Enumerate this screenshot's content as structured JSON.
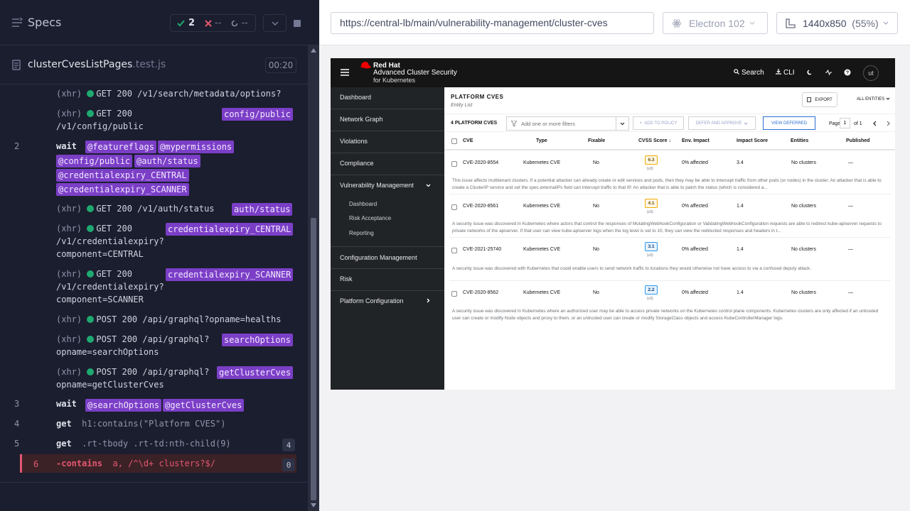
{
  "runner": {
    "specs_title": "Specs",
    "stats": {
      "passed": "2",
      "failed": "--",
      "pending": "--"
    },
    "spec_file": {
      "name": "clusterCvesListPages",
      "ext": ".test.js",
      "duration": "00:20"
    },
    "commands": {
      "c0_method": "(xhr)",
      "c0_text": "GET 200 /v1/search/metadata/options?",
      "c1_method": "(xhr)",
      "c1_text": "GET 200",
      "c1_text2": "/v1/config/public",
      "c1_alias": "config/public",
      "c2_num": "2",
      "c2_cmd": "wait",
      "c2_a1": "@featureflags",
      "c2_a2": "@mypermissions",
      "c2_a3": "@config/public",
      "c2_a4": "@auth/status",
      "c2_a5": "@credentialexpiry_CENTRAL",
      "c2_a6": "@credentialexpiry_SCANNER",
      "c3_method": "(xhr)",
      "c3_text": "GET 200 /v1/auth/status",
      "c3_alias": "auth/status",
      "c4_method": "(xhr)",
      "c4_text": "GET 200",
      "c4_text2": "/v1/credentialexpiry?",
      "c4_text3": "component=CENTRAL",
      "c4_alias": "credentialexpiry_CENTRAL",
      "c5_method": "(xhr)",
      "c5_text": "GET 200",
      "c5_text2": "/v1/credentialexpiry?",
      "c5_text3": "component=SCANNER",
      "c5_alias": "credentialexpiry_SCANNER",
      "c6_method": "(xhr)",
      "c6_text": "POST 200 /api/graphql?opname=healths",
      "c7_method": "(xhr)",
      "c7_text": "POST 200 /api/graphql?",
      "c7_text2": "opname=searchOptions",
      "c7_alias": "searchOptions",
      "c8_method": "(xhr)",
      "c8_text": "POST 200 /api/graphql?",
      "c8_text2": "opname=getClusterCves",
      "c8_alias": "getClusterCves",
      "c9_num": "3",
      "c9_cmd": "wait",
      "c9_a1": "@searchOptions",
      "c9_a2": "@getClusterCves",
      "c10_num": "4",
      "c10_cmd": "get",
      "c10_arg": "h1:contains(\"Platform CVES\")",
      "c11_num": "5",
      "c11_cmd": "get",
      "c11_arg": ".rt-tbody .rt-td:nth-child(9)",
      "c11_count": "4",
      "c12_num": "6",
      "c12_cmd": "-contains",
      "c12_arg": "a, /^\\d+ clusters?$/",
      "c12_count": "0"
    }
  },
  "browser": {
    "url": "https://central-lb/main/vulnerability-management/cluster-cves",
    "browser_name": "Electron 102",
    "viewport": "1440x850",
    "scale": "(55%)"
  },
  "app": {
    "brand": {
      "line1": "Red Hat",
      "line2": "Advanced Cluster Security",
      "line3": "for Kubernetes"
    },
    "header": {
      "search": "Search",
      "cli": "CLI",
      "avatar": "ut"
    },
    "nav": {
      "dashboard": "Dashboard",
      "network_graph": "Network Graph",
      "violations": "Violations",
      "compliance": "Compliance",
      "vuln_mgmt": "Vulnerability Management",
      "sub_dashboard": "Dashboard",
      "sub_risk_acceptance": "Risk Acceptance",
      "sub_reporting": "Reporting",
      "config_mgmt": "Configuration Management",
      "risk": "Risk",
      "platform_config": "Platform Configuration"
    },
    "page": {
      "title": "PLATFORM CVES",
      "subtitle": "Entity List",
      "export": "EXPORT",
      "all_entities": "ALL ENTITIES",
      "count": "4 PLATFORM CVES",
      "filter_placeholder": "Add one or more filters",
      "add_to_policy": "ADD TO POLICY",
      "defer_approve": "DEFER AND APPROVE",
      "view_deferred": "VIEW DEFERRED",
      "page_label": "Page",
      "page_num": "1",
      "page_of": "of 1"
    },
    "columns": {
      "cve": "CVE",
      "type": "Type",
      "fixable": "Fixable",
      "cvss": "CVSS Score",
      "env": "Env. Impact",
      "impact": "Impact Score",
      "entities": "Entities",
      "published": "Published"
    },
    "rows": [
      {
        "cve": "CVE-2020-8554",
        "type": "Kubernetes CVE",
        "fixable": "No",
        "cvss": "6.3",
        "cvss_ver": "(v3)",
        "env": "0% affected",
        "impact": "3.4",
        "entities": "No clusters",
        "published": "—",
        "desc": "This issue affects multitenant clusters. If a potential attacker can already create or edit services and pods, then they may be able to intercept traffic from other pods (or nodes) in the cluster. An attacker that is able to create a ClusterIP service and set the spec.externalIPs field can intercept traffic to that IP. An attacker that is able to patch the status (which is considered a..."
      },
      {
        "cve": "CVE-2020-8561",
        "type": "Kubernetes CVE",
        "fixable": "No",
        "cvss": "4.1",
        "cvss_ver": "(v3)",
        "env": "0% affected",
        "impact": "1.4",
        "entities": "No clusters",
        "published": "—",
        "desc": "A security issue was discovered in Kubernetes where actors that control the responses of MutatingWebhookConfiguration or ValidatingWebhookConfiguration requests are able to redirect kube-apiserver requests to private networks of the apiserver. If that user can view kube-apiserver logs when the log level is set to 10, they can view the redirected responses and headers in t..."
      },
      {
        "cve": "CVE-2021-25740",
        "type": "Kubernetes CVE",
        "fixable": "No",
        "cvss": "3.1",
        "cvss_ver": "(v3)",
        "env": "0% affected",
        "impact": "1.4",
        "entities": "No clusters",
        "published": "—",
        "desc": "A security issue was discovered with Kubernetes that could enable users to send network traffic to locations they would otherwise not have access to via a confused deputy attack."
      },
      {
        "cve": "CVE-2020-8562",
        "type": "Kubernetes CVE",
        "fixable": "No",
        "cvss": "2.2",
        "cvss_ver": "(v3)",
        "env": "0% affected",
        "impact": "1.4",
        "entities": "No clusters",
        "published": "—",
        "desc": "A security issue was discovered in Kubernetes where an authorized user may be able to access private networks on the Kubernetes control plane components. Kubernetes clusters are only affected if an untrusted user can create or modify Node objects and proxy to them, or an untrusted user can create or modify StorageClass objects and access KubeControllerManager logs."
      }
    ],
    "colors": {
      "medium": "#f0ab00",
      "low": "#2b9af3",
      "accent": "#7b3fc7",
      "fail": "#e45770",
      "pass": "#1fa971"
    }
  }
}
